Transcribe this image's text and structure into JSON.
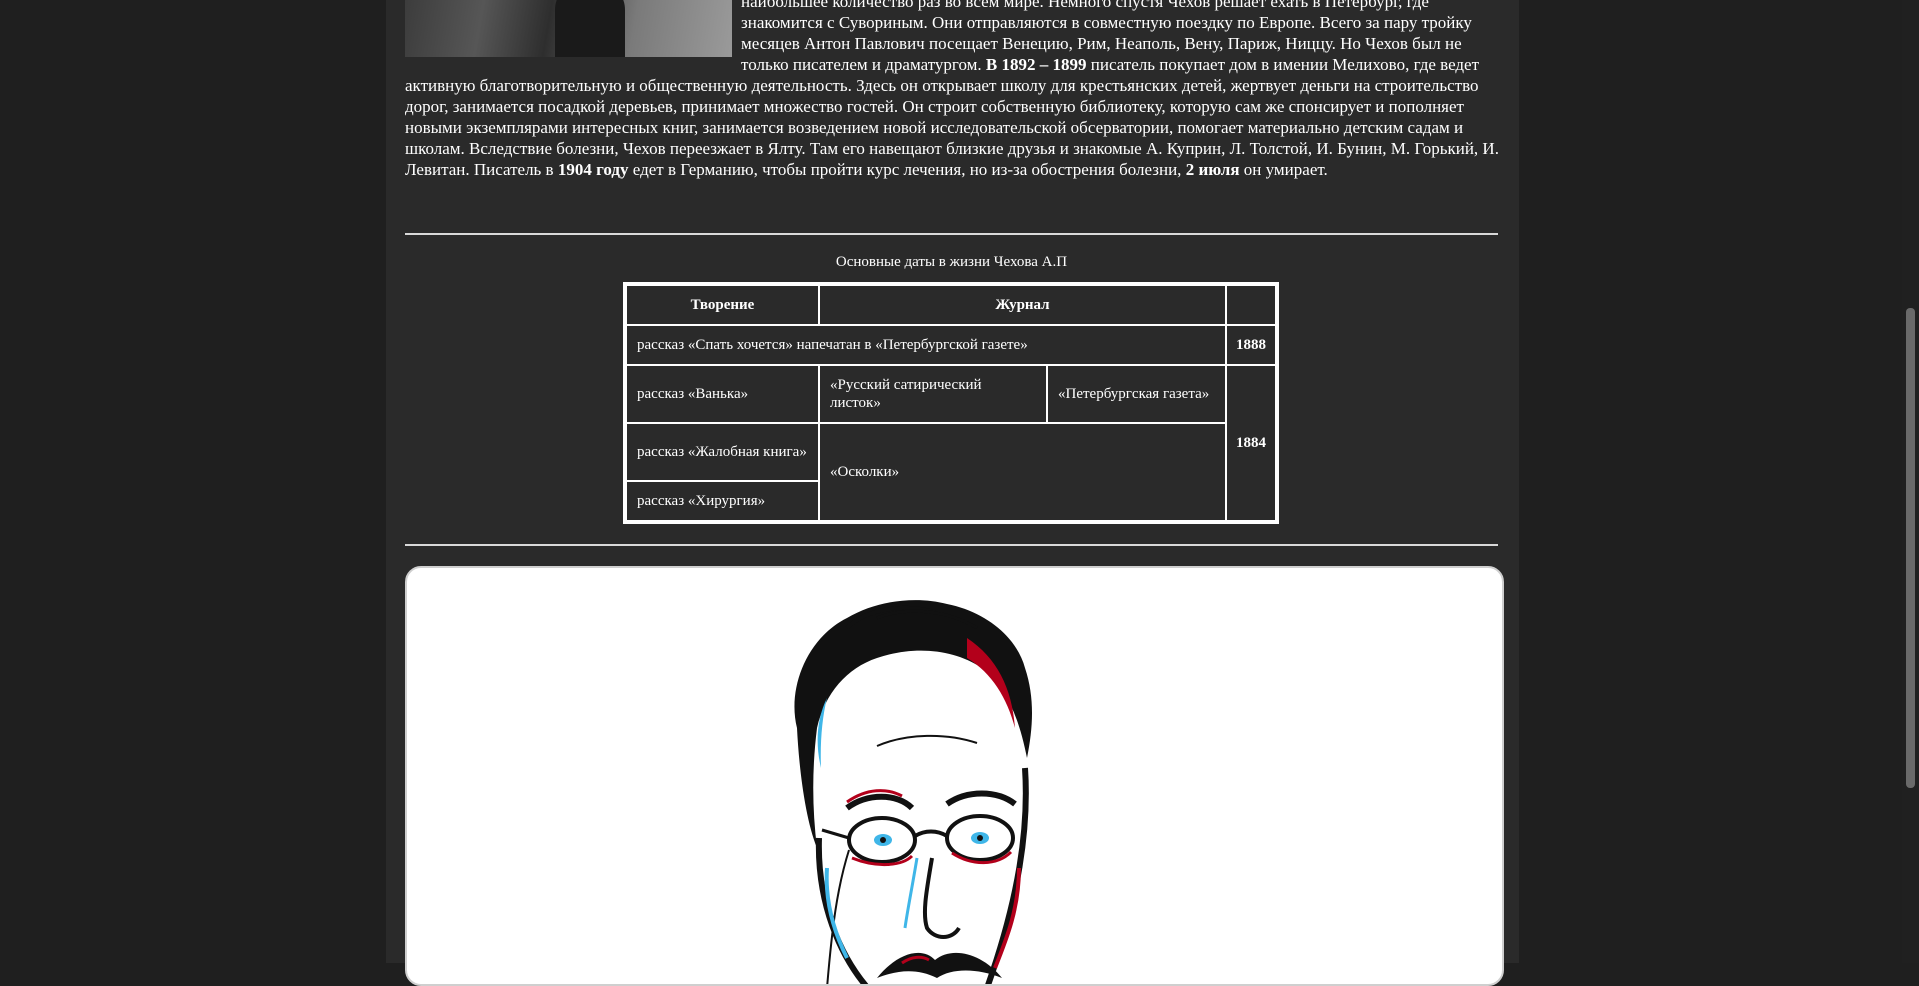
{
  "article": {
    "line1_suffix": "наибольшее количество раз во всем мире. Немного спустя Чехов решает ехать в Петербург, где знакомится с Сувориным. Они отправляются в совместную поездку по Европе. Всего за пару тройку месяцев Антон Павлович посещает Венецию, Рим, Неаполь, Вену, Париж, Ниццу. Но Чехов был не только писателем и драматургом.",
    "bold_1892": "В 1892 – 1899",
    "middle": "писатель покупает дом в имении Мелихово, где ведет активную благотворительную и общественную деятельность. Здесь он открывает школу для крестьянских детей, жертвует деньги на строительство дорог, занимается посадкой деревьев, принимает множество гостей. Он строит собственную библиотеку, которую сам же спонсирует и пополняет новыми экземплярами интересных книг, занимается возведением новой исследовательской обсерватории, помогает материально детским садам и школам. Вследствие болезни, Чехов переезжает в Ялту. Там его навещают близкие друзья и знакомые А. Куприн, Л. Толстой, И. Бунин, М. Горький, И. Левитан. Писатель в",
    "bold_1904": "1904 году",
    "middle2": "едет в Германию, чтобы пройти курс лечения, но из-за обострения болезни,",
    "bold_date": "2 июля",
    "end": "он умирает."
  },
  "table": {
    "caption": "Основные даты в жизни Чехова А.П",
    "headers": [
      "Творение",
      "Журнал",
      ""
    ],
    "row1": {
      "work": "рассказ «Спать хочется» напечатан в «Петербургской газете»",
      "year": "1888"
    },
    "row2": {
      "work": "рассказ «Ванька»",
      "journal_a": "«Русский сатирический листок»",
      "journal_b": "«Петербургская газета»"
    },
    "row3": {
      "work": "рассказ «Жалобная книга»"
    },
    "row4": {
      "work": "рассказ «Хирургия»"
    },
    "oskolki": "«Осколки»",
    "year_group": "1884"
  },
  "portrait": {
    "subject": "illustration",
    "accent_red": "#b3001b",
    "accent_blue": "#3fb6e8"
  }
}
